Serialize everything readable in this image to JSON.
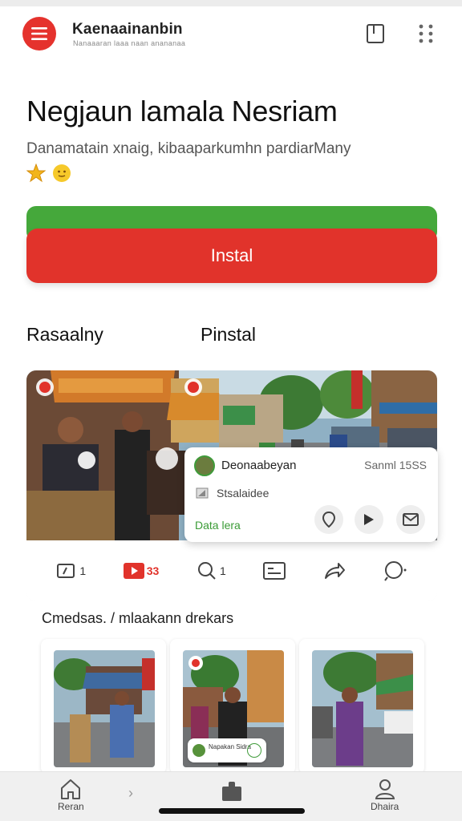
{
  "header": {
    "app_name": "Kaenaainanbin",
    "app_sub": "Nanaaaran laaa naan anananaa",
    "menu_icon": "hamburger-icon",
    "book_icon": "book-icon",
    "more_icon": "more-vertical-icon"
  },
  "hero": {
    "title": "Negjaun lamala Nesriam",
    "subtitle": "Danamatain xnaig, kibaaparkumhn pardiarMany",
    "emojis": [
      "star-emoji",
      "smiley-emoji"
    ]
  },
  "install": {
    "label": "Instal"
  },
  "tabs": [
    {
      "label": "Rasaalny"
    },
    {
      "label": "Pinstal"
    }
  ],
  "post": {
    "overlay": {
      "name": "Deonaabeyan",
      "meta": "Sanml 15SS",
      "subtitle": "Stsalaidee",
      "link": "Data lera"
    },
    "actions": [
      {
        "icon": "comment-box-icon",
        "count": "1"
      },
      {
        "icon": "video-play-icon",
        "count": "33"
      },
      {
        "icon": "search-icon",
        "count": "1"
      },
      {
        "icon": "image-icon",
        "count": ""
      },
      {
        "icon": "share-icon",
        "count": ""
      },
      {
        "icon": "chat-icon",
        "count": ""
      }
    ]
  },
  "section": {
    "label": "Cmedsas. / mlaakann drekars"
  },
  "thumbs": [
    {
      "caption": ""
    },
    {
      "caption": "Napakan Sidra"
    },
    {
      "caption": ""
    }
  ],
  "nav": {
    "home": "Reran",
    "profile": "Dhaira"
  },
  "colors": {
    "accent_red": "#e1332b",
    "accent_green": "#45a83b"
  }
}
